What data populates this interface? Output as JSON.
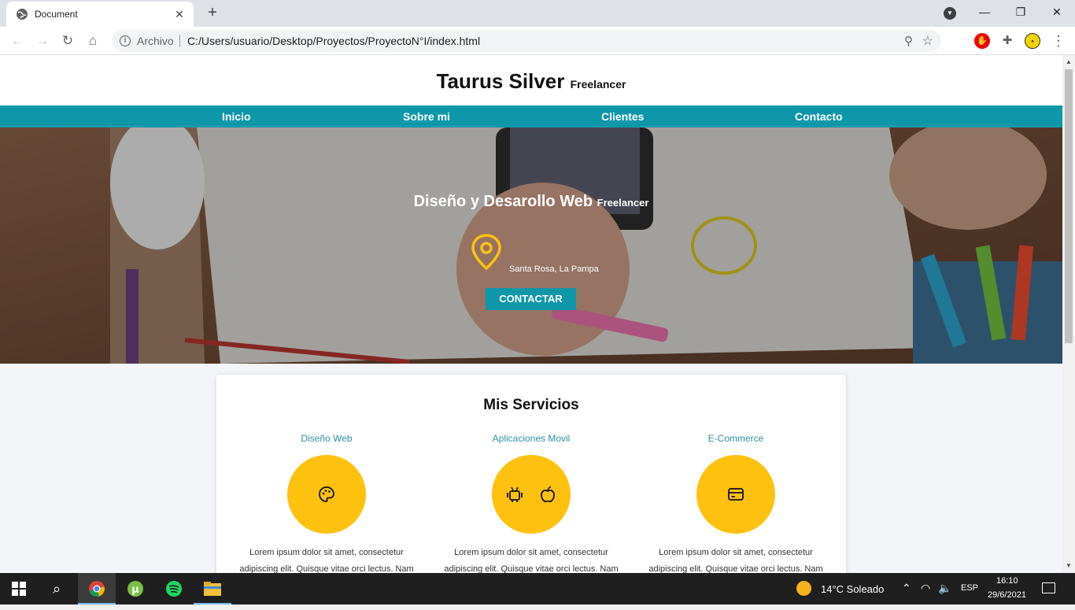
{
  "browser": {
    "tab_title": "Document",
    "tab_close": "✕",
    "new_tab": "+",
    "scheme_label": "Archivo",
    "url": "C:/Users/usuario/Desktop/Proyectos/ProyectoN°I/index.html",
    "window_controls": {
      "minimize": "—",
      "restore": "❐",
      "close": "✕"
    }
  },
  "site": {
    "brand": "Taurus Silver",
    "brand_sub": "Freelancer",
    "nav": [
      "Inicio",
      "Sobre mi",
      "Clientes",
      "Contacto"
    ],
    "hero": {
      "title": "Diseño y Desarollo Web",
      "title_sub": "Freelancer",
      "location": "Santa Rosa, La Pampa",
      "cta": "CONTACTAR"
    },
    "services": {
      "title": "Mis Servicios",
      "items": [
        {
          "name": "Diseño Web",
          "icon": "palette-icon",
          "text": "Lorem ipsum dolor sit amet, consectetur adipiscing elit. Quisque vitae orci lectus. Nam"
        },
        {
          "name": "Aplicaciones Movil",
          "icon": "android-apple-icon",
          "text": "Lorem ipsum dolor sit amet, consectetur adipiscing elit. Quisque vitae orci lectus. Nam"
        },
        {
          "name": "E-Commerce",
          "icon": "credit-card-icon",
          "text": "Lorem ipsum dolor sit amet, consectetur adipiscing elit. Quisque vitae orci lectus. Nam"
        }
      ]
    }
  },
  "taskbar": {
    "weather": "14°C  Soleado",
    "language": "ESP",
    "time": "16:10",
    "date": "29/6/2021"
  },
  "colors": {
    "accent": "#0e97a8",
    "service_circle": "#fec10e",
    "pin": "#fec10e"
  }
}
